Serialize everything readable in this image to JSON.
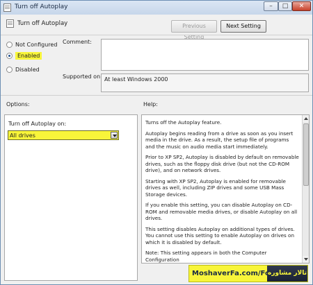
{
  "window": {
    "title": "Turn off Autoplay",
    "controls": {
      "minimize": "–",
      "maximize": "□",
      "close": "✕"
    }
  },
  "header": {
    "title": "Turn off Autoplay",
    "prev_label": "Previous Setting",
    "next_label": "Next Setting"
  },
  "state": {
    "options": [
      "Not Configured",
      "Enabled",
      "Disabled"
    ],
    "selected": "Enabled"
  },
  "comment": {
    "label": "Comment:",
    "value": ""
  },
  "supported": {
    "label": "Supported on:",
    "value": "At least Windows 2000"
  },
  "options_panel": {
    "title": "Options:",
    "field_label": "Turn off Autoplay on:",
    "selected_value": "All drives"
  },
  "help_panel": {
    "title": "Help:",
    "paragraphs": [
      "Turns off the Autoplay feature.",
      "Autoplay begins reading from a drive as soon as you insert media in the drive. As a result, the setup file of programs and the music on audio media start immediately.",
      "Prior to XP SP2, Autoplay is disabled by default on removable drives, such as the floppy disk drive (but not the CD-ROM drive), and on network drives.",
      "Starting with XP SP2, Autoplay is enabled for removable drives as well, including ZIP drives and some USB Mass Storage devices.",
      "If you enable this setting, you can disable Autoplay on CD-ROM and removable media drives, or disable Autoplay on all drives.",
      "This setting disables Autoplay on additional types of drives. You cannot use this setting to enable Autoplay on drives on which it is disabled by default.",
      "Note: This setting appears in both the Computer Configuration"
    ]
  },
  "watermark": {
    "text": "MoshaverFa.com/Forum",
    "logo_text": "تالار مشاوره"
  },
  "colors": {
    "highlight": "#f8f53a"
  }
}
